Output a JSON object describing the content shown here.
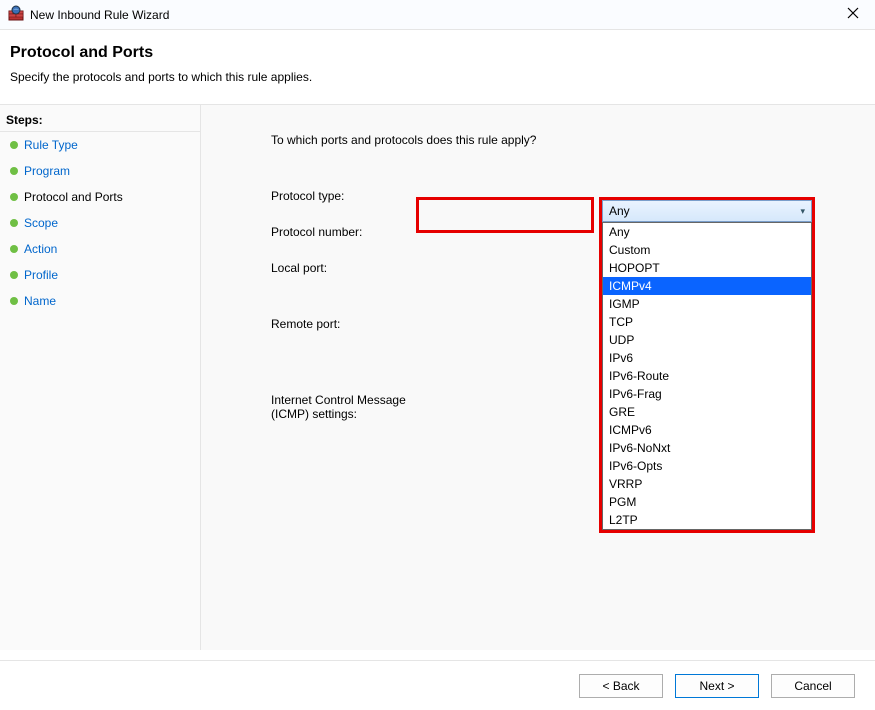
{
  "window": {
    "title": "New Inbound Rule Wizard"
  },
  "header": {
    "title": "Protocol and Ports",
    "subtitle": "Specify the protocols and ports to which this rule applies."
  },
  "steps": {
    "title": "Steps:",
    "items": [
      {
        "label": "Rule Type",
        "current": false
      },
      {
        "label": "Program",
        "current": false
      },
      {
        "label": "Protocol and Ports",
        "current": true
      },
      {
        "label": "Scope",
        "current": false
      },
      {
        "label": "Action",
        "current": false
      },
      {
        "label": "Profile",
        "current": false
      },
      {
        "label": "Name",
        "current": false
      }
    ]
  },
  "main": {
    "prompt": "To which ports and protocols does this rule apply?",
    "labels": {
      "protocol_type": "Protocol type:",
      "protocol_number": "Protocol number:",
      "local_port": "Local port:",
      "remote_port": "Remote port:",
      "icmp_settings_line1": "Internet Control Message",
      "icmp_settings_line2": "(ICMP) settings:"
    },
    "protocol_dropdown": {
      "selected": "Any",
      "highlighted": "ICMPv4",
      "options": [
        "Any",
        "Custom",
        "HOPOPT",
        "ICMPv4",
        "IGMP",
        "TCP",
        "UDP",
        "IPv6",
        "IPv6-Route",
        "IPv6-Frag",
        "GRE",
        "ICMPv6",
        "IPv6-NoNxt",
        "IPv6-Opts",
        "VRRP",
        "PGM",
        "L2TP"
      ]
    }
  },
  "footer": {
    "back": "< Back",
    "next": "Next >",
    "cancel": "Cancel"
  }
}
